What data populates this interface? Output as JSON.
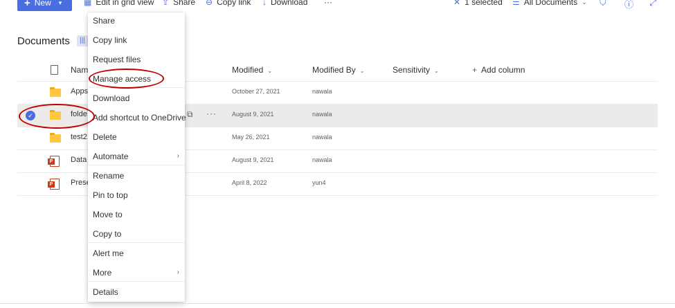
{
  "toolbar": {
    "new_label": "New",
    "edit_grid_label": "Edit in grid view",
    "share_label": "Share",
    "copy_link_label": "Copy link",
    "download_label": "Download",
    "more_label": "···",
    "selected_label": "1 selected",
    "view_label": "All Documents"
  },
  "page": {
    "title": "Documents"
  },
  "columns": {
    "name": "Name",
    "modified": "Modified",
    "modified_by": "Modified By",
    "sensitivity": "Sensitivity",
    "add_column": "Add column"
  },
  "rows": [
    {
      "name": "Apps",
      "modified": "October 27, 2021",
      "modified_by": "nawala",
      "icon": "folder-icon"
    },
    {
      "name": "folde",
      "modified": "August 9, 2021",
      "modified_by": "nawala",
      "icon": "folder-icon",
      "selected": true
    },
    {
      "name": "test2",
      "modified": "May 26, 2021",
      "modified_by": "nawala",
      "icon": "folder-icon"
    },
    {
      "name": "Data",
      "modified": "August 9, 2021",
      "modified_by": "nawala",
      "icon": "powerpoint-icon"
    },
    {
      "name": "Prese",
      "modified": "April 8, 2022",
      "modified_by": "yun4",
      "icon": "powerpoint-icon"
    }
  ],
  "context_menu": {
    "items": [
      "Share",
      "Copy link",
      "Request files",
      "Manage access",
      "Download",
      "Add shortcut to OneDrive",
      "Delete",
      "Automate",
      "Rename",
      "Pin to top",
      "Move to",
      "Copy to",
      "Alert me",
      "More",
      "Details"
    ]
  },
  "colors": {
    "accent": "#4a6ee0",
    "annotation": "#c00000",
    "selected_row": "#edebe9"
  }
}
